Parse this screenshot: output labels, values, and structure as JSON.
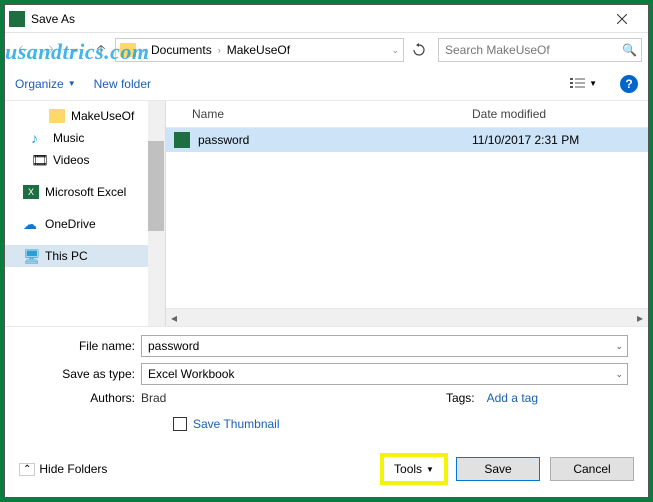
{
  "titlebar": {
    "title": "Save As"
  },
  "watermark": "usandtrics.com",
  "nav": {
    "crumb1": "Documents",
    "crumb2": "MakeUseOf",
    "search_placeholder": "Search MakeUseOf"
  },
  "toolbar": {
    "organize": "Organize",
    "new_folder": "New folder"
  },
  "tree": {
    "items": [
      {
        "label": "MakeUseOf",
        "type": "folder"
      },
      {
        "label": "Music",
        "type": "music"
      },
      {
        "label": "Videos",
        "type": "video"
      },
      {
        "label": "Microsoft Excel",
        "type": "excel"
      },
      {
        "label": "OneDrive",
        "type": "onedrive"
      },
      {
        "label": "This PC",
        "type": "pc"
      }
    ]
  },
  "columns": {
    "name": "Name",
    "date": "Date modified"
  },
  "files": [
    {
      "name": "password",
      "date": "11/10/2017 2:31 PM"
    }
  ],
  "form": {
    "filename_label": "File name:",
    "filename_value": "password",
    "type_label": "Save as type:",
    "type_value": "Excel Workbook",
    "authors_label": "Authors:",
    "authors_value": "Brad",
    "tags_label": "Tags:",
    "tags_value": "Add a tag",
    "thumbnail": "Save Thumbnail"
  },
  "footer": {
    "hide": "Hide Folders",
    "tools": "Tools",
    "save": "Save",
    "cancel": "Cancel"
  }
}
